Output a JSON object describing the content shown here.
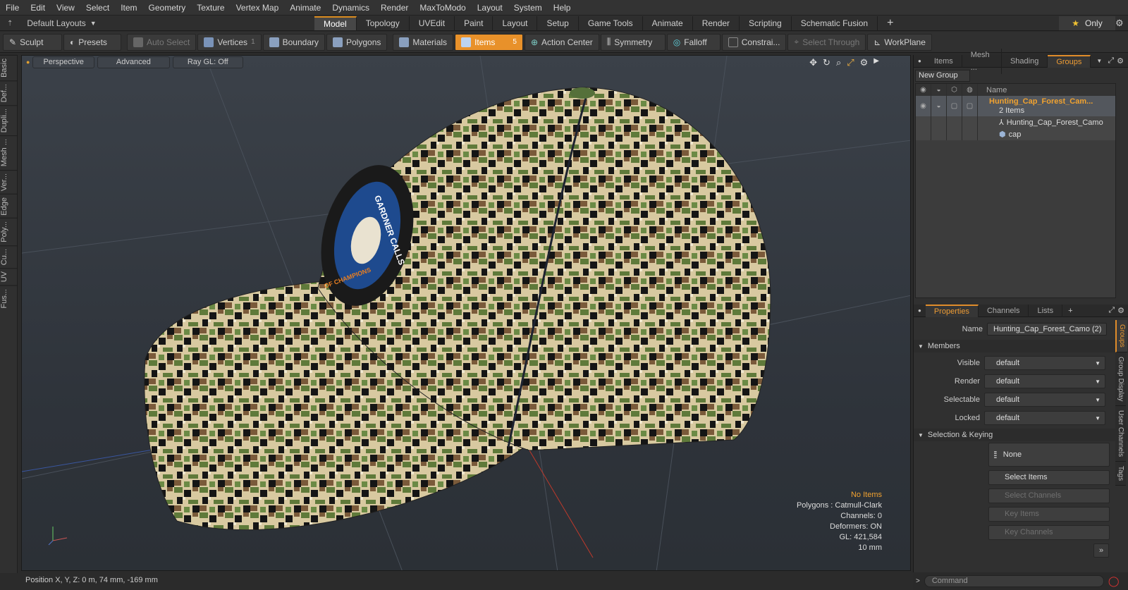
{
  "menu": [
    "File",
    "Edit",
    "View",
    "Select",
    "Item",
    "Geometry",
    "Texture",
    "Vertex Map",
    "Animate",
    "Dynamics",
    "Render",
    "MaxToModo",
    "Layout",
    "System",
    "Help"
  ],
  "layout_bar": {
    "layout_dropdown": "Default Layouts",
    "tabs": [
      "Model",
      "Topology",
      "UVEdit",
      "Paint",
      "Layout",
      "Setup",
      "Game Tools",
      "Animate",
      "Render",
      "Scripting",
      "Schematic Fusion"
    ],
    "active_tab": "Model",
    "only_label": "Only"
  },
  "toolbar": {
    "sculpt": "Sculpt",
    "presets": "Presets",
    "auto_select": "Auto Select",
    "vertices": "Vertices",
    "vertices_count": "1",
    "boundary": "Boundary",
    "polygons": "Polygons",
    "materials": "Materials",
    "items": "Items",
    "items_count": "5",
    "action_center": "Action Center",
    "symmetry": "Symmetry",
    "falloff": "Falloff",
    "constraints": "Constrai...",
    "select_through": "Select Through",
    "workplane": "WorkPlane"
  },
  "left_tabs": [
    "Basic",
    "Def...",
    "Dupli...",
    "Mesh ...",
    "Ver...",
    "Edge",
    "Poly...",
    "Cu...",
    "UV",
    "Fus..."
  ],
  "viewport": {
    "perspective": "Perspective",
    "advanced": "Advanced",
    "raygl": "Ray GL: Off",
    "patch_text_1": "GARDNER CALLS",
    "patch_text_2": "OF CHAMPIONS",
    "info": {
      "no_items": "No Items",
      "polygons": "Polygons : Catmull-Clark",
      "channels": "Channels: 0",
      "deformers": "Deformers: ON",
      "gl": "GL: 421,584",
      "scale": "10 mm"
    }
  },
  "status": {
    "position": "Position X, Y, Z:   0 m, 74 mm, -169 mm"
  },
  "right_top": {
    "tabs": [
      "Items",
      "Mesh ...",
      "Shading",
      "Groups"
    ],
    "active_tab": "Groups",
    "new_group": "New Group",
    "name_col": "Name",
    "group_name": "Hunting_Cap_Forest_Cam...",
    "group_count": "2 Items",
    "children": [
      "Hunting_Cap_Forest_Camo",
      "cap"
    ]
  },
  "properties": {
    "tabs": [
      "Properties",
      "Channels",
      "Lists"
    ],
    "active_tab": "Properties",
    "name_label": "Name",
    "name_value": "Hunting_Cap_Forest_Camo (2)",
    "members_header": "Members",
    "rows": [
      {
        "label": "Visible",
        "value": "default"
      },
      {
        "label": "Render",
        "value": "default"
      },
      {
        "label": "Selectable",
        "value": "default"
      },
      {
        "label": "Locked",
        "value": "default"
      }
    ],
    "keying_header": "Selection & Keying",
    "none_btn": "None",
    "select_items": "Select Items",
    "select_channels": "Select Channels",
    "key_items": "Key Items",
    "key_channels": "Key Channels",
    "side_tabs": [
      "Groups",
      "Group Display",
      "User Channels",
      "Tags"
    ]
  },
  "command": {
    "placeholder": "Command"
  },
  "colors": {
    "accent": "#e8912a",
    "selected_text": "#f0a230"
  }
}
